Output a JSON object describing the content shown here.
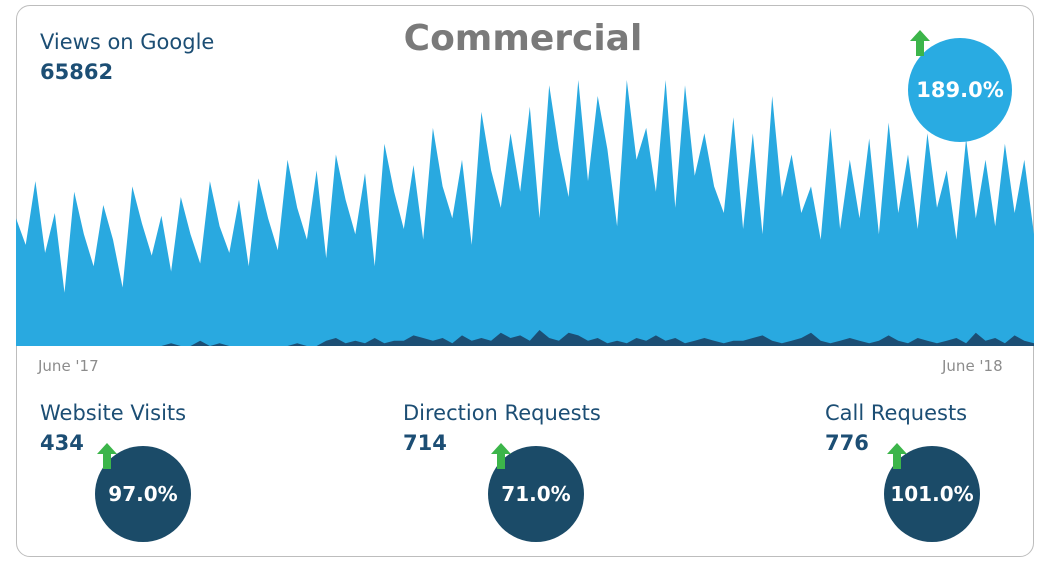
{
  "title": "Commercial",
  "colors": {
    "area": "#29a9e0",
    "secondary": "#1c4e74",
    "badge_big": "#29abe2",
    "badge_small": "#1b4b68",
    "arrow": "#3cb54a",
    "text": "#1c4e74"
  },
  "views": {
    "label": "Views on Google",
    "value": "65862",
    "change": "189.0%",
    "icon": "up-arrow-icon"
  },
  "axis": {
    "start": "June '17",
    "end": "June '18"
  },
  "metrics": [
    {
      "label": "Website Visits",
      "value": "434",
      "change": "97.0%",
      "icon": "up-arrow-icon"
    },
    {
      "label": "Direction Requests",
      "value": "714",
      "change": "71.0%",
      "icon": "up-arrow-icon"
    },
    {
      "label": "Call Requests",
      "value": "776",
      "change": "101.0%",
      "icon": "up-arrow-icon"
    }
  ],
  "chart_data": {
    "type": "area",
    "x_start": "June '17",
    "x_end": "June '18",
    "ylim": [
      0,
      100
    ],
    "grid": false,
    "legend": "none",
    "series": [
      {
        "values": [
          48,
          38,
          62,
          35,
          50,
          20,
          58,
          42,
          30,
          53,
          40,
          22,
          60,
          46,
          34,
          49,
          28,
          56,
          42,
          31,
          62,
          45,
          35,
          55,
          30,
          63,
          48,
          36,
          70,
          52,
          40,
          66,
          33,
          72,
          55,
          42,
          65,
          30,
          76,
          58,
          44,
          68,
          40,
          82,
          60,
          48,
          70,
          38,
          88,
          66,
          52,
          80,
          58,
          90,
          48,
          98,
          74,
          56,
          100,
          62,
          94,
          74,
          45,
          102,
          70,
          82,
          58,
          108,
          52,
          98,
          64,
          80,
          60,
          50,
          86,
          44,
          80,
          42,
          94,
          56,
          72,
          50,
          60,
          40,
          82,
          44,
          70,
          48,
          78,
          42,
          84,
          50,
          72,
          44,
          80,
          52,
          66,
          40,
          78,
          48,
          70,
          45,
          76,
          50,
          70,
          42
        ]
      },
      {
        "values": [
          0,
          0,
          0,
          0,
          0,
          0,
          0,
          0,
          0,
          0,
          0,
          0,
          0,
          0,
          0,
          0,
          1,
          0,
          0,
          2,
          0,
          1,
          0,
          0,
          0,
          0,
          0,
          0,
          0,
          1,
          0,
          0,
          2,
          3,
          1,
          2,
          1,
          3,
          1,
          2,
          2,
          4,
          3,
          2,
          3,
          1,
          4,
          2,
          3,
          2,
          5,
          3,
          4,
          2,
          6,
          3,
          2,
          5,
          4,
          2,
          3,
          1,
          2,
          1,
          3,
          2,
          4,
          2,
          3,
          1,
          2,
          3,
          2,
          1,
          2,
          2,
          3,
          4,
          2,
          1,
          2,
          3,
          5,
          2,
          1,
          2,
          3,
          2,
          1,
          2,
          4,
          2,
          1,
          3,
          2,
          1,
          2,
          3,
          1,
          5,
          2,
          3,
          1,
          4,
          2,
          1
        ]
      }
    ]
  }
}
